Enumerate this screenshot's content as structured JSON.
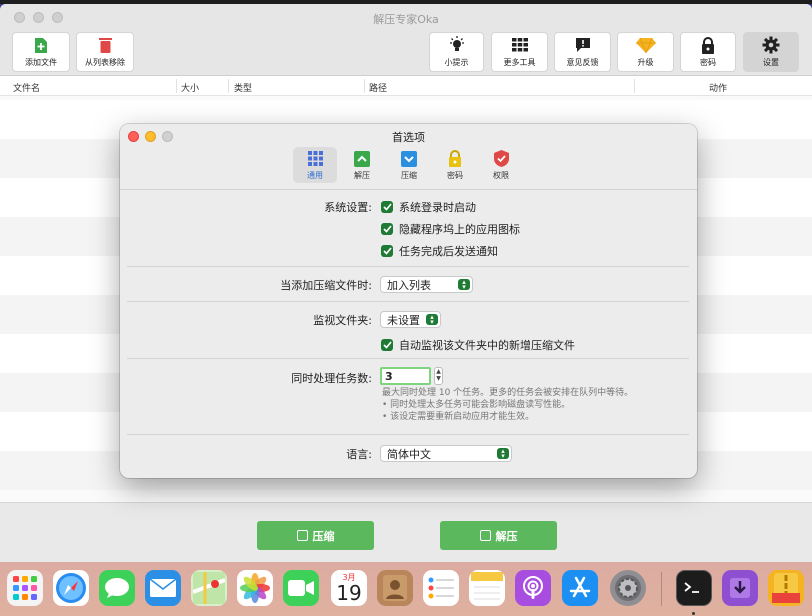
{
  "window": {
    "title": "解压专家Oka"
  },
  "toolbar": {
    "add_file": "添加文件",
    "remove_from_list": "从列表移除",
    "tips": "小提示",
    "more_tools": "更多工具",
    "feedback": "意见反馈",
    "upgrade": "升级",
    "password": "密码",
    "settings": "设置"
  },
  "table": {
    "columns": [
      "文件名",
      "大小",
      "类型",
      "路径",
      "动作"
    ]
  },
  "bottom": {
    "compress": "压缩",
    "extract": "解压"
  },
  "prefs": {
    "title": "首选项",
    "tabs": [
      "通用",
      "解压",
      "压缩",
      "密码",
      "权限"
    ],
    "system_settings_label": "系统设置:",
    "system_checks": [
      "系统登录时启动",
      "隐藏程序坞上的应用图标",
      "任务完成后发送通知"
    ],
    "when_add_label": "当添加压缩文件时:",
    "when_add_value": "加入列表",
    "watch_folder_label": "监视文件夹:",
    "watch_folder_value": "未设置",
    "watch_check": "自动监视该文件夹中的新增压缩文件",
    "concurrent_label": "同时处理任务数:",
    "concurrent_value": "3",
    "concurrent_notes": [
      "最大同时处理 10 个任务。更多的任务会被安排在队列中等待。",
      "• 同时处理太多任务可能会影响磁盘读写性能。",
      "• 该设定需要重新启动应用才能生效。"
    ],
    "language_label": "语言:",
    "language_value": "简体中文"
  },
  "dock": {
    "calendar_month": "3月",
    "calendar_day": "19",
    "icons": [
      "launchpad-icon",
      "safari-icon",
      "messages-icon",
      "mail-icon",
      "maps-icon",
      "photos-icon",
      "facetime-icon",
      "calendar-icon",
      "contacts-icon",
      "reminders-icon",
      "notes-icon",
      "podcasts-icon",
      "app-store-icon",
      "system-preferences-icon",
      "terminal-icon",
      "downloader-icon",
      "archive-utility-icon"
    ]
  },
  "colors": {
    "accent_green": "#5cb85c",
    "check_green": "#1e7a35"
  }
}
